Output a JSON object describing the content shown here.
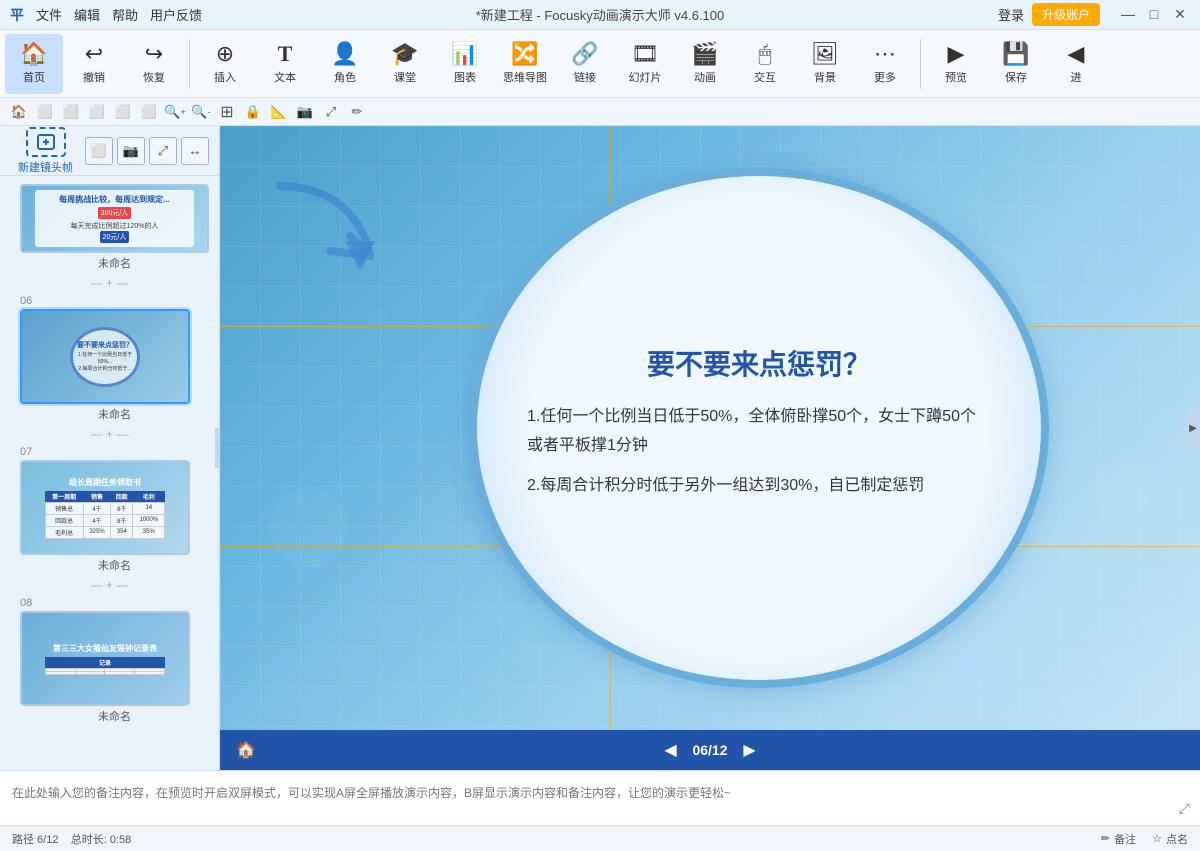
{
  "titlebar": {
    "logo": "平",
    "menus": [
      "文件",
      "编辑",
      "帮助",
      "用户反馈"
    ],
    "title": "*新建工程 - Focusky动画演示大师  v4.6.100",
    "login": "登录",
    "upgrade": "升级账户",
    "min": "—",
    "max": "□",
    "close": "✕"
  },
  "toolbar": {
    "items": [
      {
        "id": "home",
        "icon": "🏠",
        "label": "首页"
      },
      {
        "id": "undo",
        "icon": "↩",
        "label": "撤销"
      },
      {
        "id": "redo",
        "icon": "↪",
        "label": "恢复"
      },
      {
        "id": "insert",
        "icon": "⊕",
        "label": "插入"
      },
      {
        "id": "text",
        "icon": "T",
        "label": "文本"
      },
      {
        "id": "role",
        "icon": "👤",
        "label": "角色"
      },
      {
        "id": "class",
        "icon": "🎓",
        "label": "课堂"
      },
      {
        "id": "chart",
        "icon": "📊",
        "label": "图表"
      },
      {
        "id": "mindmap",
        "icon": "🔀",
        "label": "思维导图"
      },
      {
        "id": "link",
        "icon": "🔗",
        "label": "链接"
      },
      {
        "id": "slide",
        "icon": "🎞",
        "label": "幻灯片"
      },
      {
        "id": "animate",
        "icon": "🎬",
        "label": "动画"
      },
      {
        "id": "interact",
        "icon": "🖱",
        "label": "交互"
      },
      {
        "id": "bg",
        "icon": "🖼",
        "label": "背景"
      },
      {
        "id": "more",
        "icon": "⋯",
        "label": "更多"
      },
      {
        "id": "preview",
        "icon": "▶",
        "label": "预览"
      },
      {
        "id": "save",
        "icon": "💾",
        "label": "保存"
      },
      {
        "id": "nav",
        "icon": "◀",
        "label": "进"
      }
    ]
  },
  "actionbar": {
    "buttons": [
      "🏠",
      "⬜",
      "⬜",
      "⬜",
      "⬜",
      "⬜",
      "🔍+",
      "🔍-",
      "⊞",
      "⊟",
      "📐",
      "🔒",
      "📷",
      "⤢",
      "✏"
    ]
  },
  "sidebar": {
    "new_frame_label": "新建镜头帧",
    "tools": [
      "⬜",
      "📷",
      "⤢",
      "↔"
    ],
    "slides": [
      {
        "num": "",
        "label": "未命名",
        "type": "05"
      },
      {
        "num": "06",
        "label": "未命名",
        "type": "06",
        "active": true
      },
      {
        "num": "07",
        "label": "未命名",
        "type": "07"
      },
      {
        "num": "08",
        "label": "未命名",
        "type": "08"
      }
    ]
  },
  "canvas": {
    "content": {
      "title": "要不要来点惩罚？",
      "points": [
        "1.任何一个比例当日低于50%，全体俯卧撑50个，女士下蹲50个或者平板撑1分钟",
        "2.每周合计积分时低于另外一组达到30%，自已制定惩罚"
      ]
    }
  },
  "bottom_nav": {
    "home_icon": "🏠",
    "prev_icon": "◀",
    "page": "06/12",
    "next_icon": "▶"
  },
  "notes": {
    "placeholder": "在此处输入您的备注内容，在预览时开启双屏模式，可以实现A屏全屏播放演示内容，B屏显示演示内容和备注内容，让您的演示更轻松~"
  },
  "statusbar": {
    "path": "路径 6/12",
    "duration": "总时长: 0:58",
    "notes_btn": "备注",
    "points_btn": "点名"
  }
}
